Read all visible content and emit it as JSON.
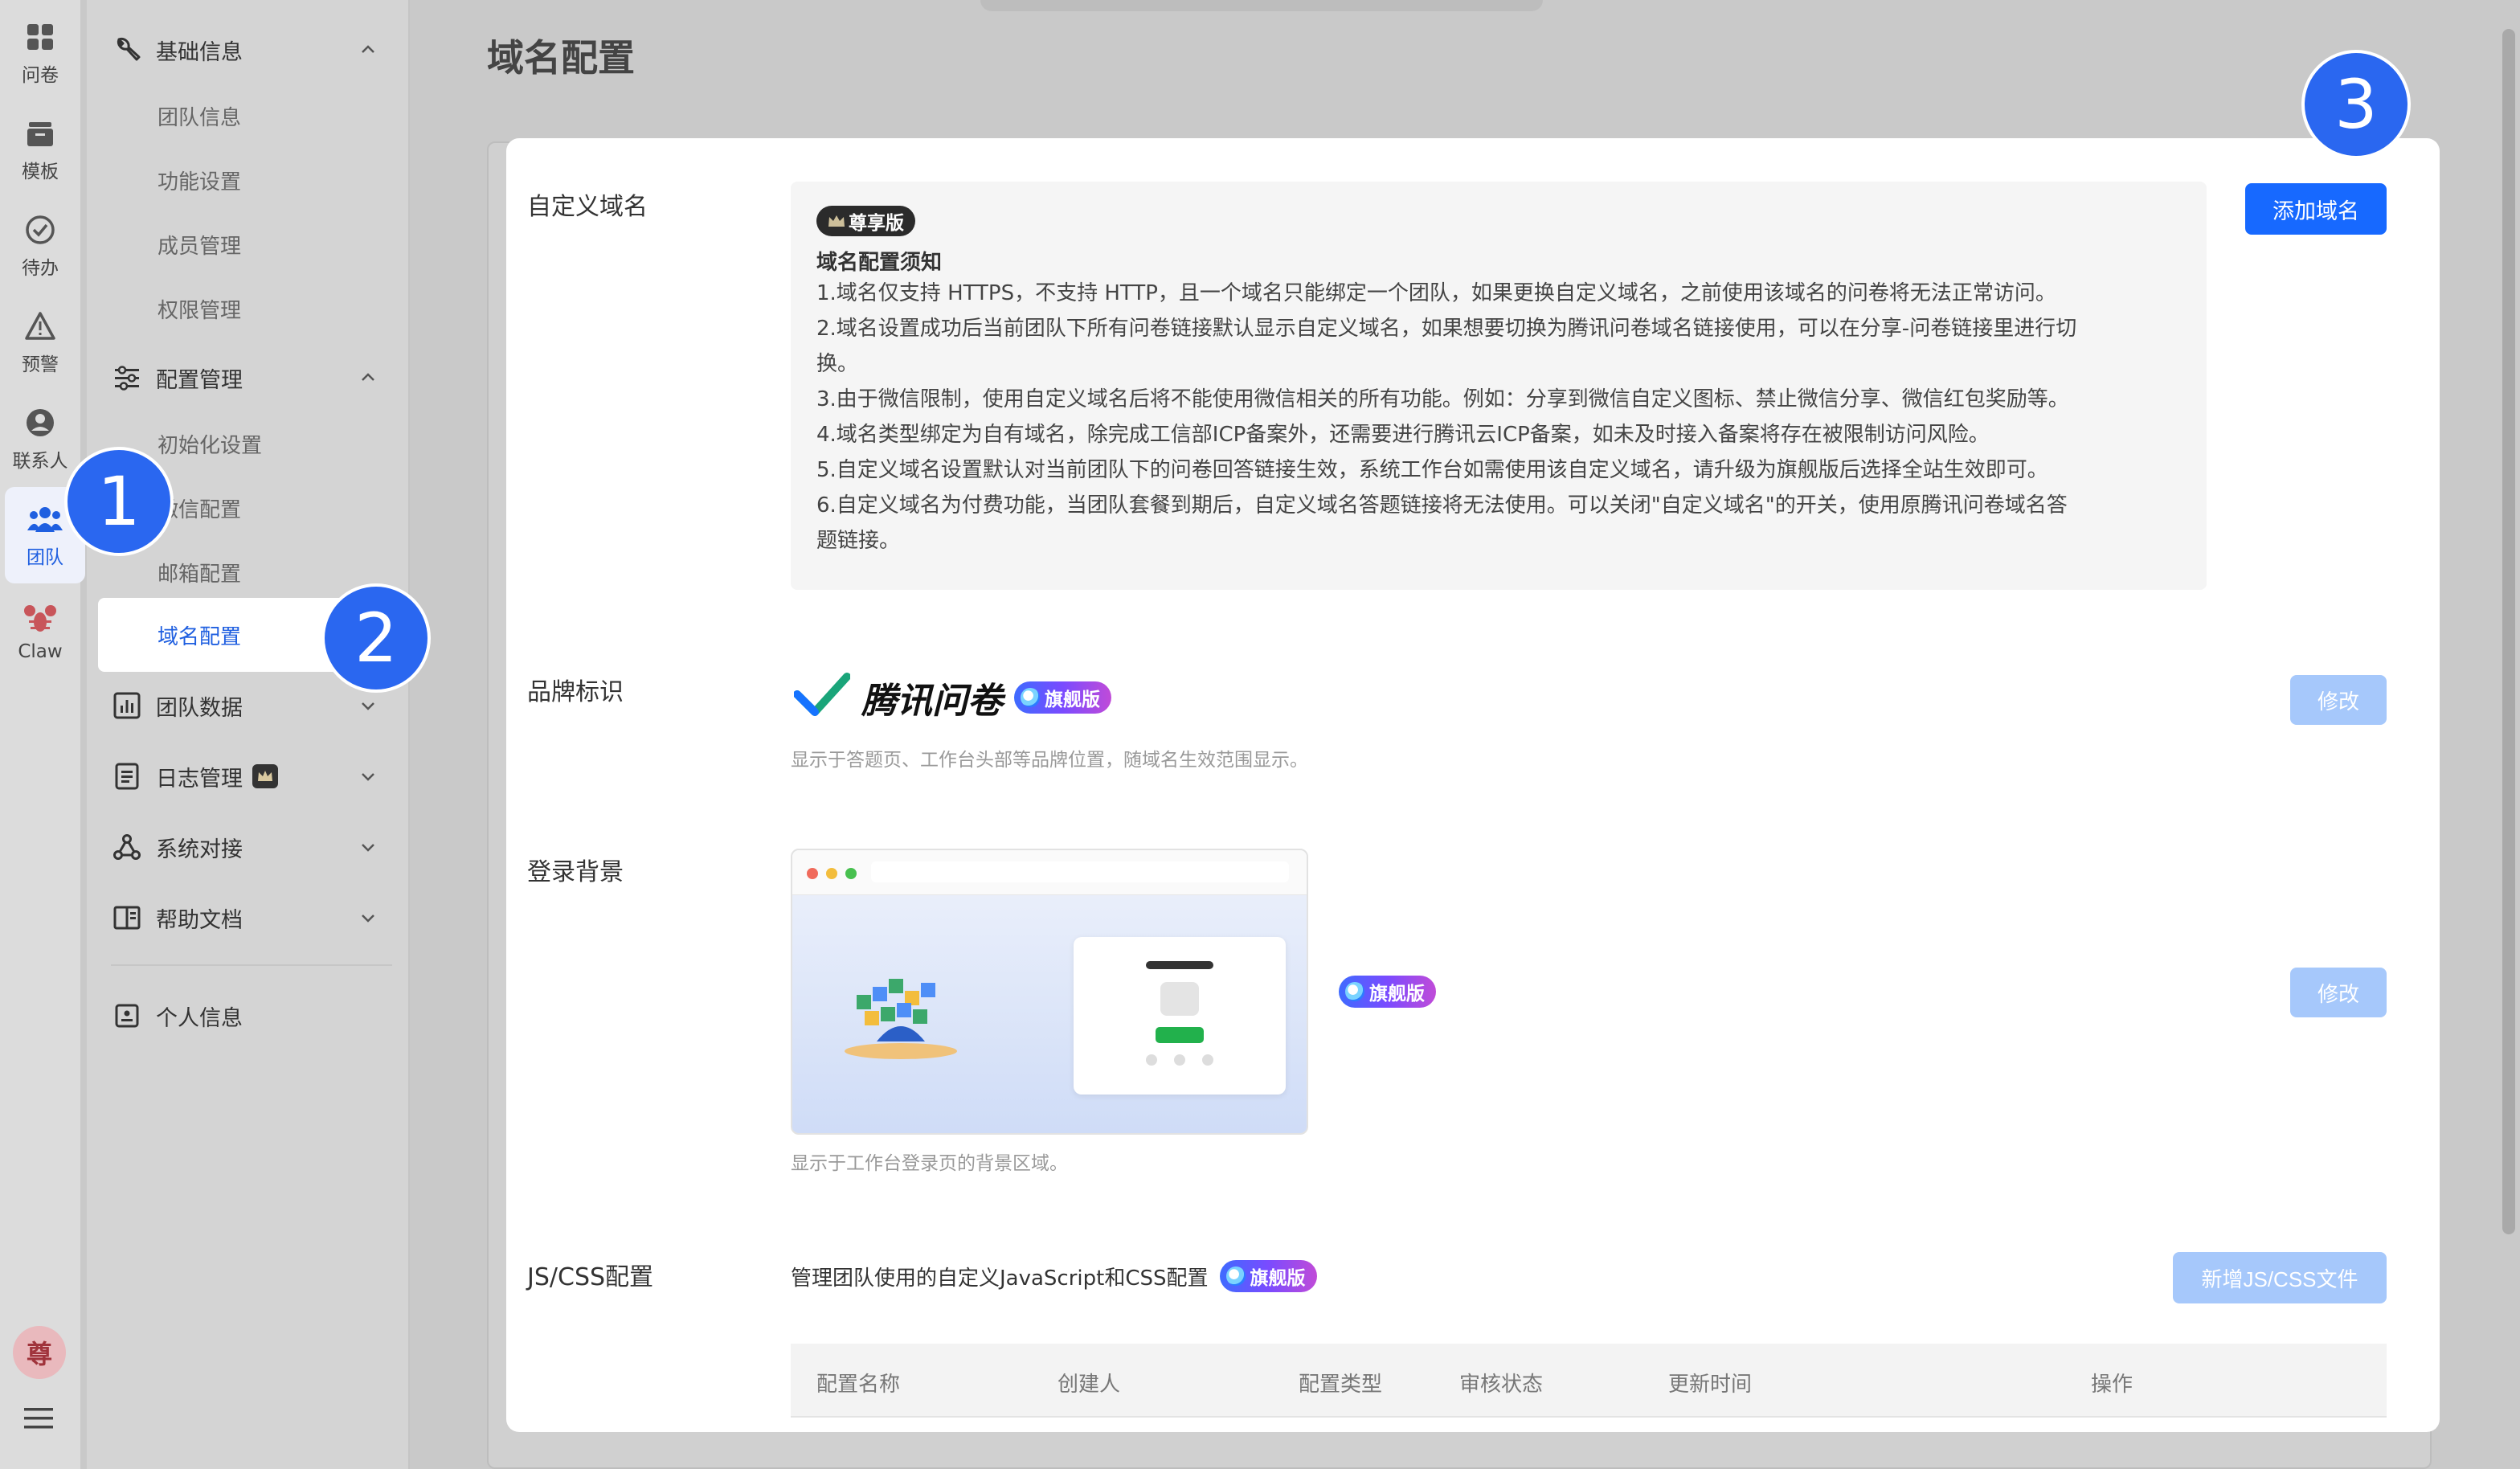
{
  "rail": {
    "items": [
      {
        "label": "问卷",
        "icon": "grid-icon"
      },
      {
        "label": "模板",
        "icon": "template-icon"
      },
      {
        "label": "待办",
        "icon": "check-circle-icon"
      },
      {
        "label": "预警",
        "icon": "warning-icon"
      },
      {
        "label": "联系人",
        "icon": "contact-icon"
      },
      {
        "label": "团队",
        "icon": "team-icon"
      },
      {
        "label": "Claw",
        "icon": "lobster-icon"
      }
    ],
    "avatar_text": "尊",
    "menu_icon": "hamburger-icon"
  },
  "nav": {
    "groups": [
      {
        "label": "基础信息",
        "icon": "wrench-icon",
        "expanded": true,
        "items": [
          "团队信息",
          "功能设置",
          "成员管理",
          "权限管理"
        ]
      },
      {
        "label": "配置管理",
        "icon": "sliders-icon",
        "expanded": true,
        "items": [
          "初始化设置",
          "微信配置",
          "邮箱配置",
          "域名配置"
        ]
      },
      {
        "label": "团队数据",
        "icon": "chart-icon",
        "expanded": false
      },
      {
        "label": "日志管理",
        "icon": "log-icon",
        "expanded": false
      },
      {
        "label": "系统对接",
        "icon": "connect-icon",
        "expanded": false
      },
      {
        "label": "帮助文档",
        "icon": "book-icon",
        "expanded": false
      }
    ],
    "personal": "个人信息",
    "active_item": "域名配置"
  },
  "main": {
    "title": "域名配置",
    "custom_domain": {
      "label": "自定义域名",
      "edition_tag": "尊享版",
      "notice_title": "域名配置须知",
      "lines": [
        "1.域名仅支持 HTTPS，不支持 HTTP，且一个域名只能绑定一个团队，如果更换自定义域名，之前使用该域名的问卷将无法正常访问。",
        "2.域名设置成功后当前团队下所有问卷链接默认显示自定义域名，如果想要切换为腾讯问卷域名链接使用，可以在分享-问卷链接里进行切",
        "换。",
        "3.由于微信限制，使用自定义域名后将不能使用微信相关的所有功能。例如：分享到微信自定义图标、禁止微信分享、微信红包奖励等。",
        "4.域名类型绑定为自有域名，除完成工信部ICP备案外，还需要进行腾讯云ICP备案，如未及时接入备案将存在被限制访问风险。",
        "5.自定义域名设置默认对当前团队下的问卷回答链接生效，系统工作台如需使用该自定义域名，请升级为旗舰版后选择全站生效即可。",
        "6.自定义域名为付费功能，当团队套餐到期后，自定义域名答题链接将无法使用。可以关闭\"自定义域名\"的开关，使用原腾讯问卷域名答",
        "题链接。"
      ],
      "add_button": "添加域名"
    },
    "brand": {
      "label": "品牌标识",
      "logo_text": "腾讯问卷",
      "flag_tag": "旗舰版",
      "hint": "显示于答题页、工作台头部等品牌位置，随域名生效范围显示。",
      "edit_button": "修改"
    },
    "login_bg": {
      "label": "登录背景",
      "flag_tag": "旗舰版",
      "hint": "显示于工作台登录页的背景区域。",
      "edit_button": "修改"
    },
    "jscss": {
      "label": "JS/CSS配置",
      "desc": "管理团队使用的自定义JavaScript和CSS配置",
      "flag_tag": "旗舰版",
      "add_button": "新增JS/CSS文件",
      "columns": [
        "配置名称",
        "创建人",
        "配置类型",
        "审核状态",
        "更新时间",
        "操作"
      ]
    }
  },
  "annotations": [
    "1",
    "2",
    "3"
  ],
  "colors": {
    "primary": "#1769ff",
    "active_text": "#1f5fe0",
    "badge": "#2a67f0"
  }
}
